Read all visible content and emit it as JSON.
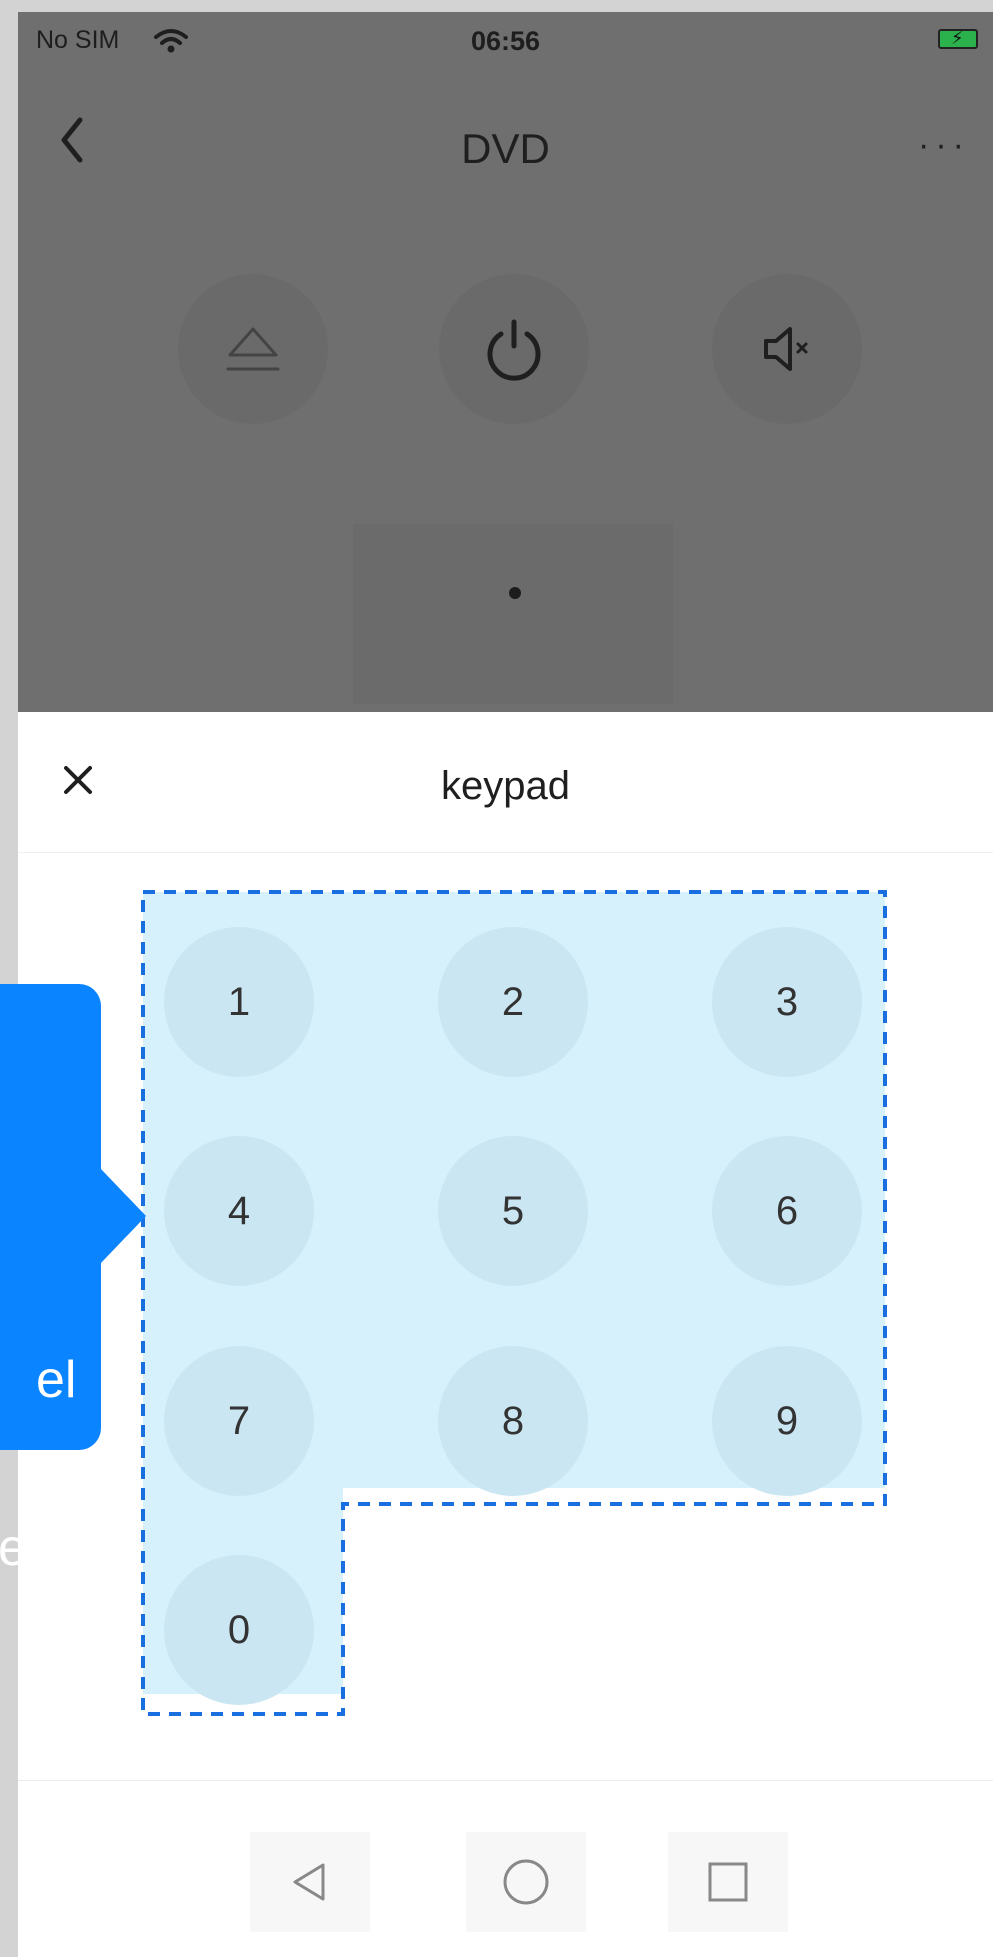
{
  "status_bar": {
    "carrier": "No SIM",
    "time": "06:56"
  },
  "nav": {
    "title": "DVD"
  },
  "remote_buttons": [
    {
      "name": "eject"
    },
    {
      "name": "power"
    },
    {
      "name": "mute"
    }
  ],
  "sheet": {
    "title": "keypad"
  },
  "keys": [
    "1",
    "2",
    "3",
    "4",
    "5",
    "6",
    "7",
    "8",
    "9",
    "0"
  ],
  "callout": {
    "line1": "el",
    "line2": "e"
  },
  "colors": {
    "accent": "#0a84ff",
    "highlight": "#d6f1fc",
    "dashed_border": "#1a6fe0"
  }
}
